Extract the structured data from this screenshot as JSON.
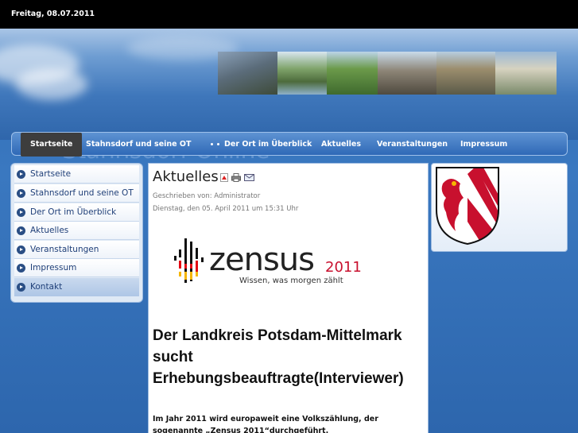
{
  "header": {
    "date": "Freitag, 08.07.2011",
    "site_title": "Stahnsdorf Online"
  },
  "nav": {
    "items": [
      {
        "label": "Startseite",
        "active": true
      },
      {
        "label": "Stahnsdorf und seine OT"
      },
      {
        "label": "Der Ort im Überblick"
      },
      {
        "label": "Aktuelles"
      },
      {
        "label": "Veranstaltungen"
      },
      {
        "label": "Impressum"
      }
    ]
  },
  "sidebar": {
    "items": [
      {
        "label": "Startseite"
      },
      {
        "label": "Stahnsdorf und seine OT"
      },
      {
        "label": "Der Ort im Überblick"
      },
      {
        "label": "Aktuelles"
      },
      {
        "label": "Veranstaltungen"
      },
      {
        "label": "Impressum"
      },
      {
        "label": "Kontakt"
      }
    ]
  },
  "article": {
    "title": "Aktuelles",
    "author": "Geschrieben von: Administrator",
    "date": "Dienstag, den 05. April 2011 um 15:31 Uhr",
    "logo": {
      "word": "zensus",
      "year": "2011",
      "tagline": "Wissen, was morgen zählt"
    },
    "headline": "Der Landkreis Potsdam-Mittelmark sucht Erhebungsbeauftragte(Interviewer)",
    "body": "Im Jahr 2011 wird europaweit eine Volkszählung, der sogenannte „Zensus 2011“durchgeführt."
  },
  "colors": {
    "topbar": "#000000",
    "nav_bg": "#2f69b7",
    "nav_active": "#3d3d3d",
    "crest_red": "#c8102e"
  }
}
